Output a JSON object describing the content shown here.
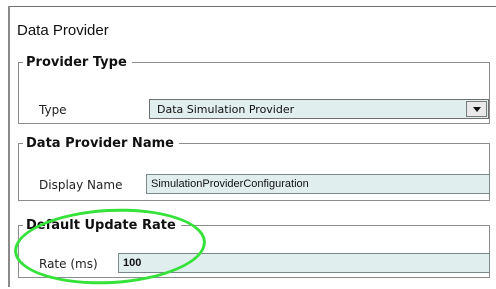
{
  "panel": {
    "title": "Data Provider"
  },
  "provider_type": {
    "legend": "Provider Type",
    "type_label": "Type",
    "type_value": "Data Simulation Provider"
  },
  "provider_name": {
    "legend": "Data Provider Name",
    "display_label": "Display Name",
    "display_value": "SimulationProviderConfiguration"
  },
  "update_rate": {
    "legend": "Default Update Rate",
    "rate_label": "Rate (ms)",
    "rate_value": "100"
  },
  "colors": {
    "field_bg": "#e0eeed",
    "highlight": "#35e23a",
    "border": "#8c8c8c"
  },
  "icons": {
    "dropdown": "chevron-down-icon"
  }
}
